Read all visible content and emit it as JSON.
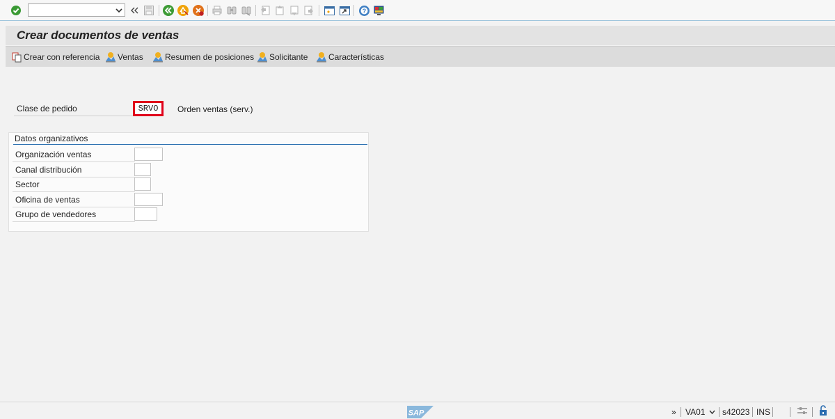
{
  "toolbar": {
    "command_field_value": "",
    "icons": [
      "enter-icon",
      "command-dropdown-icon",
      "collapse-icon",
      "save-icon",
      "back-icon",
      "exit-icon",
      "cancel-icon",
      "print-icon",
      "find-icon",
      "find-next-icon",
      "first-page-icon",
      "previous-page-icon",
      "next-page-icon",
      "last-page-icon",
      "new-session-icon",
      "shortcut-icon",
      "help-icon",
      "customize-layout-icon"
    ]
  },
  "title": "Crear documentos de ventas",
  "app_toolbar": {
    "buttons": [
      {
        "label": "Crear con referencia"
      },
      {
        "label": "Ventas"
      },
      {
        "label": "Resumen de posiciones"
      },
      {
        "label": "Solicitante"
      },
      {
        "label": "Características"
      }
    ]
  },
  "order_type": {
    "label": "Clase de pedido",
    "value": "SRVO",
    "description": "Orden ventas (serv.)"
  },
  "org_data": {
    "title": "Datos organizativos",
    "fields": [
      {
        "label": "Organización ventas",
        "value": ""
      },
      {
        "label": "Canal distribución",
        "value": ""
      },
      {
        "label": "Sector",
        "value": ""
      },
      {
        "label": "Oficina de ventas",
        "value": ""
      },
      {
        "label": "Grupo de vendedores",
        "value": ""
      }
    ]
  },
  "status_bar": {
    "logo_text": "SAP",
    "expand": "»",
    "transaction": "VA01",
    "server": "s42023",
    "mode": "INS"
  },
  "colors": {
    "highlight": "#e0001a",
    "group_underline": "#2a6fb0"
  }
}
